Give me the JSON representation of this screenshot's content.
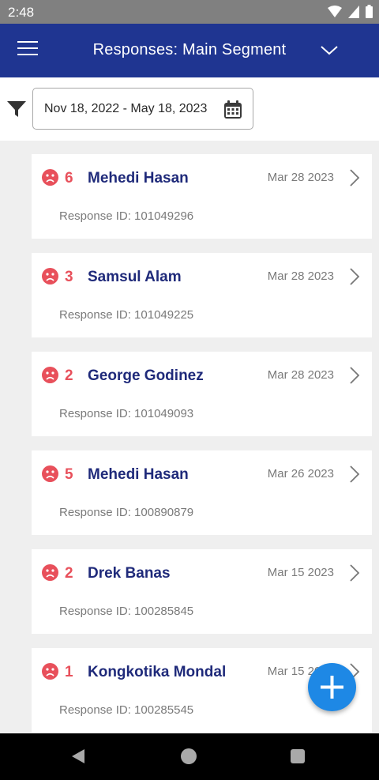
{
  "status_bar": {
    "time": "2:48"
  },
  "app_bar": {
    "title": "Responses: Main Segment"
  },
  "filter": {
    "date_range": "Nov 18, 2022 - May 18, 2023"
  },
  "responses": [
    {
      "score": "6",
      "name": "Mehedi Hasan",
      "date": "Mar 28 2023",
      "response_id": "Response ID: 101049296"
    },
    {
      "score": "3",
      "name": "Samsul Alam",
      "date": "Mar 28 2023",
      "response_id": "Response ID: 101049225"
    },
    {
      "score": "2",
      "name": "George Godinez",
      "date": "Mar 28 2023",
      "response_id": "Response ID: 101049093"
    },
    {
      "score": "5",
      "name": "Mehedi Hasan",
      "date": "Mar 26 2023",
      "response_id": "Response ID: 100890879"
    },
    {
      "score": "2",
      "name": "Drek Banas",
      "date": "Mar 15 2023",
      "response_id": "Response ID: 100285845"
    },
    {
      "score": "1",
      "name": "Kongkotika Mondal",
      "date": "Mar 15 2023",
      "response_id": "Response ID: 100285545"
    }
  ],
  "colors": {
    "app_bar": "#1f3591",
    "detractor": "#e8505b",
    "name": "#1f2a7a",
    "fab": "#1e88e5"
  },
  "icons": {
    "menu": "hamburger-menu-icon",
    "dropdown": "chevron-down-icon",
    "filter": "filter-funnel-icon",
    "calendar": "calendar-icon",
    "sentiment": "sad-face-icon",
    "open": "chevron-right-icon",
    "fab": "plus-icon"
  }
}
